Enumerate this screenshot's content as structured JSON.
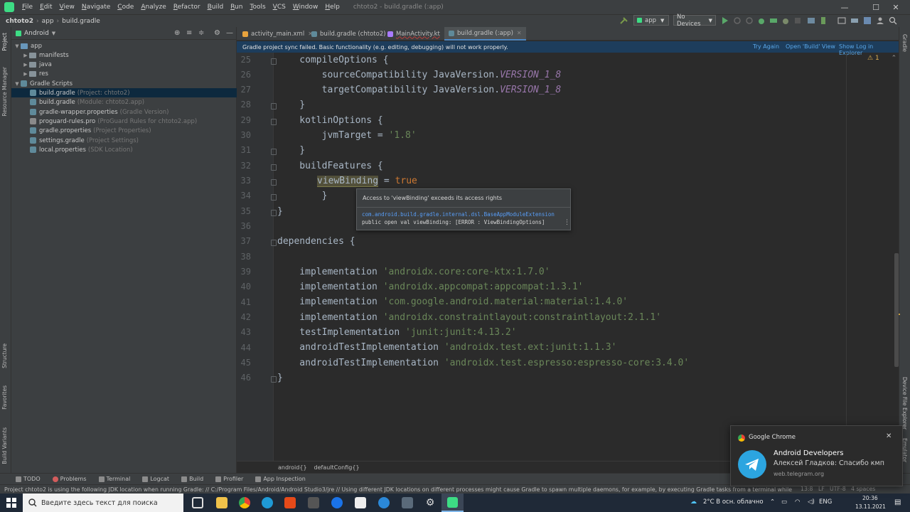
{
  "menubar": {
    "items": [
      "File",
      "Edit",
      "View",
      "Navigate",
      "Code",
      "Analyze",
      "Refactor",
      "Build",
      "Run",
      "Tools",
      "VCS",
      "Window",
      "Help"
    ],
    "title": "chtoto2 - build.gradle (:app)"
  },
  "navbar": {
    "crumbs": [
      "chtoto2",
      "app",
      "build.gradle"
    ],
    "run_config": "app",
    "device": "No Devices"
  },
  "project": {
    "view_mode": "Android",
    "rows": [
      {
        "label": "app",
        "hint": ""
      },
      {
        "label": "manifests",
        "hint": ""
      },
      {
        "label": "java",
        "hint": ""
      },
      {
        "label": "res",
        "hint": ""
      },
      {
        "label": "Gradle Scripts",
        "hint": ""
      },
      {
        "label": "build.gradle",
        "hint": "(Project: chtoto2)"
      },
      {
        "label": "build.gradle",
        "hint": "(Module: chtoto2.app)"
      },
      {
        "label": "gradle-wrapper.properties",
        "hint": "(Gradle Version)"
      },
      {
        "label": "proguard-rules.pro",
        "hint": "(ProGuard Rules for chtoto2.app)"
      },
      {
        "label": "gradle.properties",
        "hint": "(Project Properties)"
      },
      {
        "label": "settings.gradle",
        "hint": "(Project Settings)"
      },
      {
        "label": "local.properties",
        "hint": "(SDK Location)"
      }
    ]
  },
  "left_stripe": {
    "project": "Project",
    "resource_manager": "Resource Manager",
    "structure": "Structure",
    "favorites": "Favorites",
    "build_variants": "Build Variants"
  },
  "right_stripe": {
    "gradle": "Gradle",
    "device_file_explorer": "Device File Explorer",
    "emulator": "Emulator"
  },
  "tabs": [
    {
      "label": "activity_main.xml",
      "color": "#e8a33d"
    },
    {
      "label": "build.gradle (chtoto2)",
      "color": "#5f8a9a"
    },
    {
      "label": "MainActivity.kt",
      "color": "#a97bff"
    },
    {
      "label": "build.gradle (:app)",
      "color": "#5f8a9a"
    }
  ],
  "banner": {
    "message": "Gradle project sync failed. Basic functionality (e.g. editing, debugging) will not work properly.",
    "try_again": "Try Again",
    "open_build_view": "Open 'Build' View",
    "show_log": "Show Log in Explorer"
  },
  "editor": {
    "line_numbers": [
      "25",
      "26",
      "27",
      "28",
      "29",
      "30",
      "31",
      "32",
      "33",
      "34",
      "35",
      "36",
      "37",
      "38",
      "39",
      "40",
      "41",
      "42",
      "43",
      "44",
      "45",
      "46"
    ],
    "warning_count": "1",
    "lines": {
      "l25": "    compileOptions {",
      "l26a": "        sourceCompatibility JavaVersion.",
      "l26b": "VERSION_1_8",
      "l27a": "        targetCompatibility JavaVersion.",
      "l27b": "VERSION_1_8",
      "l28": "    }",
      "l29": "    kotlinOptions {",
      "l30a": "        jvmTarget = ",
      "l30b": "'1.8'",
      "l31": "    }",
      "l32": "    buildFeatures {",
      "l33a": "viewBinding",
      "l33b": " = ",
      "l33c": "true",
      "l34": "        }",
      "l35": "}",
      "l37": "dependencies {",
      "l39a": "    implementation ",
      "l39b": "'androidx.core:core-ktx:1.7.0'",
      "l40a": "    implementation ",
      "l40b": "'androidx.appcompat:appcompat:1.3.1'",
      "l41a": "    implementation ",
      "l41b": "'com.google.android.material:material:1.4.0'",
      "l42a": "    implementation ",
      "l42b": "'androidx.constraintlayout:constraintlayout:2.1.1'",
      "l43a": "    testImplementation ",
      "l43b": "'junit:junit:4.13.2'",
      "l44a": "    androidTestImplementation ",
      "l44b": "'androidx.test.ext:junit:1.1.3'",
      "l45a": "    androidTestImplementation ",
      "l45b": "'androidx.test.espresso:espresso-core:3.4.0'",
      "l46": "}"
    }
  },
  "tooltip": {
    "message": "Access to 'viewBinding' exceeds its access rights",
    "fqcn": "com.android.build.gradle.internal.dsl.BaseAppModuleExtension",
    "declaration": "public open val viewBinding: [ERROR : ViewBindingOptions]",
    "more": "⋮"
  },
  "editor_breadcrumb": [
    "android{}",
    "defaultConfig{}"
  ],
  "tool_tabs": [
    "TODO",
    "Problems",
    "Terminal",
    "Logcat",
    "Build",
    "Profiler",
    "App Inspection"
  ],
  "status": {
    "message": "Project chtoto2 is using the following JDK location when running Gradle: // C:/Program Files/Android/Android Studio3/jre // Using different JDK locations on different processes might cause Gradle to spawn multiple daemons, for example, by executing Gradle tasks from a terminal while usi... (2 minutes ago)",
    "position": "13:8",
    "line_sep": "LF",
    "encoding": "UTF-8",
    "indent": "4 spaces"
  },
  "taskbar": {
    "search_placeholder": "Введите здесь текст для поиска",
    "weather": "2°C  В осн. облачно",
    "lang": "ENG",
    "time": "20:36",
    "date": "13.11.2021"
  },
  "notification": {
    "app": "Google Chrome",
    "title": "Android Developers",
    "body": "Алексей Гладков: Спасибо кмп",
    "source": "web.telegram.org"
  }
}
